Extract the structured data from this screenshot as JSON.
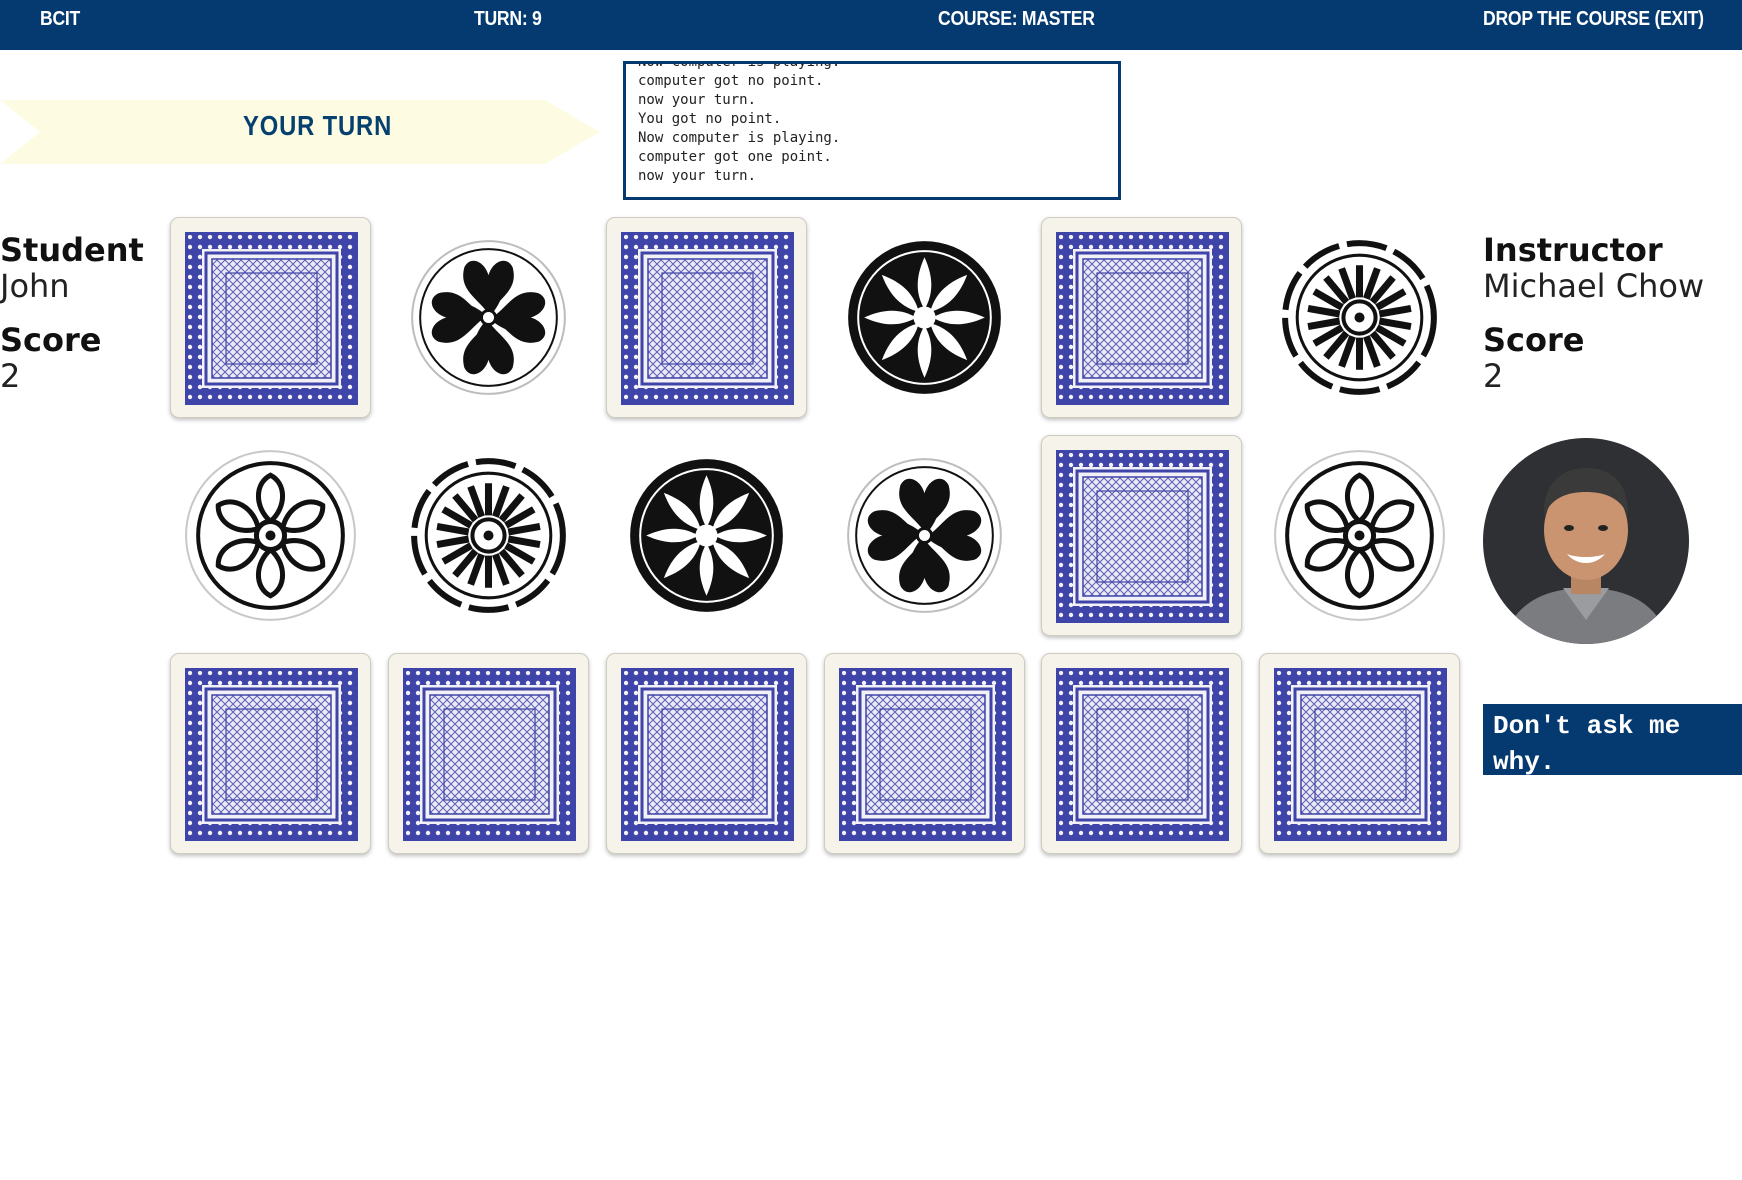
{
  "nav": {
    "school": "BCIT",
    "turn": "TURN: 9",
    "course": "COURSE: MASTER",
    "exit": "DROP THE COURSE (EXIT)"
  },
  "banner": {
    "text": "YOUR TURN"
  },
  "log": [
    "Now computer is playing.",
    "computer got no point.",
    "now your turn.",
    "You got no point.",
    "Now computer is playing.",
    "computer got one point.",
    "now your turn."
  ],
  "student": {
    "title": "Student",
    "name": "John",
    "score_label": "Score",
    "score": "2"
  },
  "instructor": {
    "title": "Instructor",
    "name": "Michael Chow",
    "score_label": "Score",
    "score": "2"
  },
  "quote": "Don't ask me why.",
  "colors": {
    "nav": "#053a70",
    "card_back": "#3f44a8",
    "banner": "#fdfbe2"
  },
  "board": {
    "rows": 3,
    "cols": 6,
    "cards": [
      [
        "back",
        "floral-heart",
        "back",
        "floral-dark",
        "back",
        "spoke-wheel"
      ],
      [
        "petal-rosette",
        "spoke-wheel",
        "floral-dark",
        "floral-heart",
        "back",
        "petal-rosette"
      ],
      [
        "back",
        "back",
        "back",
        "back",
        "back",
        "back"
      ]
    ]
  }
}
